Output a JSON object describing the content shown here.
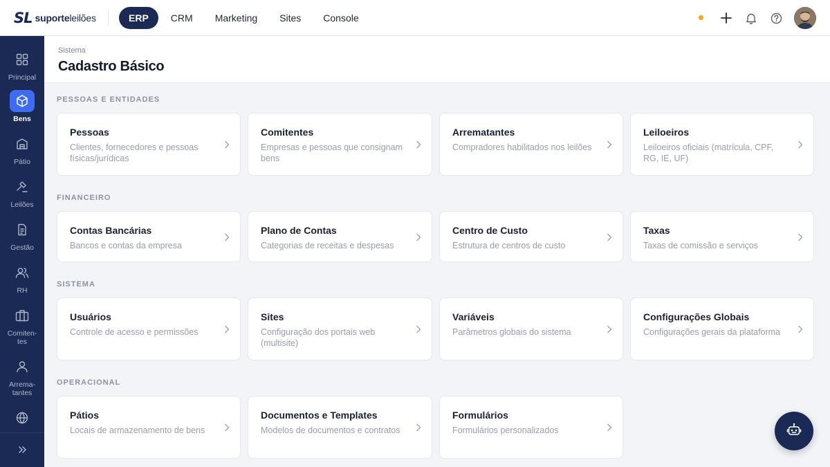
{
  "brand": {
    "mark": "SL",
    "name_bold": "suporte",
    "name_rest": "leilões"
  },
  "topnav": [
    {
      "label": "ERP",
      "active": true
    },
    {
      "label": "CRM",
      "active": false
    },
    {
      "label": "Marketing",
      "active": false
    },
    {
      "label": "Sites",
      "active": false
    },
    {
      "label": "Console",
      "active": false
    }
  ],
  "sidebar": {
    "items": [
      {
        "label": "Principal",
        "icon": "grid-icon"
      },
      {
        "label": "Bens",
        "icon": "box-icon",
        "active": true
      },
      {
        "label": "Pátio",
        "icon": "warehouse-icon"
      },
      {
        "label": "Leilões",
        "icon": "gavel-icon"
      },
      {
        "label": "Gestão",
        "icon": "document-icon"
      },
      {
        "label": "RH",
        "icon": "users-icon"
      },
      {
        "label": "Comiten-\ntes",
        "icon": "briefcase-icon"
      },
      {
        "label": "Arrema-\ntantes",
        "icon": "user-icon"
      },
      {
        "label": "",
        "icon": "globe-icon"
      }
    ],
    "expand_icon": "double-chevron-right-icon"
  },
  "header": {
    "breadcrumb": "Sistema",
    "title": "Cadastro Básico"
  },
  "sections": [
    {
      "title": "PESSOAS E ENTIDADES",
      "cards": [
        {
          "title": "Pessoas",
          "desc": "Clientes, fornecedores e pessoas físicas/jurídicas"
        },
        {
          "title": "Comitentes",
          "desc": "Empresas e pessoas que consignam bens"
        },
        {
          "title": "Arrematantes",
          "desc": "Compradores habilitados nos leilões"
        },
        {
          "title": "Leiloeiros",
          "desc": "Leiloeiros oficiais (matrícula, CPF, RG, IE, UF)"
        }
      ]
    },
    {
      "title": "FINANCEIRO",
      "cards": [
        {
          "title": "Contas Bancárias",
          "desc": "Bancos e contas da empresa"
        },
        {
          "title": "Plano de Contas",
          "desc": "Categorias de receitas e despesas"
        },
        {
          "title": "Centro de Custo",
          "desc": "Estrutura de centros de custo"
        },
        {
          "title": "Taxas",
          "desc": "Taxas de comissão e serviços"
        }
      ]
    },
    {
      "title": "SISTEMA",
      "cards": [
        {
          "title": "Usuários",
          "desc": "Controle de acesso e permissões"
        },
        {
          "title": "Sites",
          "desc": "Configuração dos portais web (multisite)"
        },
        {
          "title": "Variáveis",
          "desc": "Parâmetros globais do sistema"
        },
        {
          "title": "Configurações Globais",
          "desc": "Configurações gerais da plataforma"
        }
      ]
    },
    {
      "title": "OPERACIONAL",
      "cards": [
        {
          "title": "Pátios",
          "desc": "Locais de armazenamento de bens"
        },
        {
          "title": "Documentos e Templates",
          "desc": "Modelos de documentos e contratos"
        },
        {
          "title": "Formulários",
          "desc": "Formulários personalizados"
        }
      ]
    }
  ],
  "colors": {
    "brand": "#1b2a55",
    "accent": "#3d6cf0",
    "status_dot": "#f5a623"
  }
}
